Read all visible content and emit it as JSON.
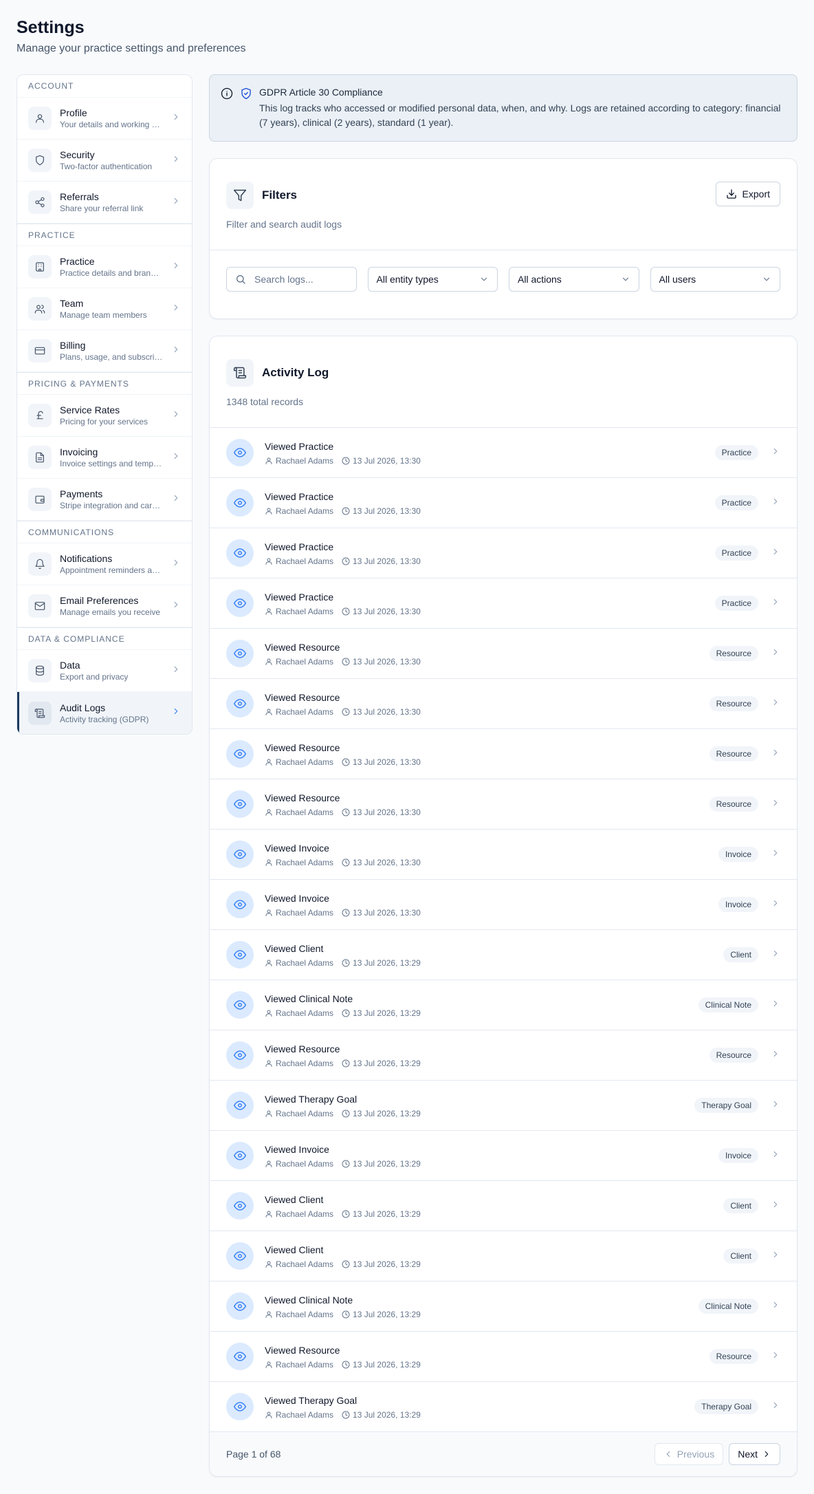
{
  "header": {
    "title": "Settings",
    "subtitle": "Manage your practice settings and preferences"
  },
  "sidebar": {
    "groups": [
      {
        "title": "Account",
        "items": [
          {
            "label": "Profile",
            "desc": "Your details and working hours",
            "icon": "user-icon"
          },
          {
            "label": "Security",
            "desc": "Two-factor authentication",
            "icon": "shield-icon"
          },
          {
            "label": "Referrals",
            "desc": "Share your referral link",
            "icon": "share-icon"
          }
        ]
      },
      {
        "title": "Practice",
        "items": [
          {
            "label": "Practice",
            "desc": "Practice details and branding",
            "icon": "building-icon"
          },
          {
            "label": "Team",
            "desc": "Manage team members",
            "icon": "users-icon"
          },
          {
            "label": "Billing",
            "desc": "Plans, usage, and subscription",
            "icon": "credit-card-icon"
          }
        ]
      },
      {
        "title": "Pricing & Payments",
        "items": [
          {
            "label": "Service Rates",
            "desc": "Pricing for your services",
            "icon": "pound-icon"
          },
          {
            "label": "Invoicing",
            "desc": "Invoice settings and templates",
            "icon": "file-text-icon"
          },
          {
            "label": "Payments",
            "desc": "Stripe integration and card payments",
            "icon": "wallet-icon"
          }
        ]
      },
      {
        "title": "Communications",
        "items": [
          {
            "label": "Notifications",
            "desc": "Appointment reminders and alerts",
            "icon": "bell-icon"
          },
          {
            "label": "Email Preferences",
            "desc": "Manage emails you receive",
            "icon": "mail-icon"
          }
        ]
      },
      {
        "title": "Data & Compliance",
        "items": [
          {
            "label": "Data",
            "desc": "Export and privacy",
            "icon": "database-icon"
          },
          {
            "label": "Audit Logs",
            "desc": "Activity tracking (GDPR)",
            "icon": "scroll-icon",
            "active": true
          }
        ]
      }
    ]
  },
  "alert": {
    "title": "GDPR Article 30 Compliance",
    "text": "This log tracks who accessed or modified personal data, when, and why. Logs are retained according to category: financial (7 years), clinical (2 years), standard (1 year)."
  },
  "filters": {
    "title": "Filters",
    "subtitle": "Filter and search audit logs",
    "export_label": "Export",
    "search_placeholder": "Search logs...",
    "entity_type": "All entity types",
    "action": "All actions",
    "user": "All users"
  },
  "activity": {
    "title": "Activity Log",
    "subtitle": "1348 total records",
    "rows": [
      {
        "title": "Viewed Practice",
        "user": "Rachael Adams",
        "time": "13 Jul 2026, 13:30",
        "badge": "Practice"
      },
      {
        "title": "Viewed Practice",
        "user": "Rachael Adams",
        "time": "13 Jul 2026, 13:30",
        "badge": "Practice"
      },
      {
        "title": "Viewed Practice",
        "user": "Rachael Adams",
        "time": "13 Jul 2026, 13:30",
        "badge": "Practice"
      },
      {
        "title": "Viewed Practice",
        "user": "Rachael Adams",
        "time": "13 Jul 2026, 13:30",
        "badge": "Practice"
      },
      {
        "title": "Viewed Resource",
        "user": "Rachael Adams",
        "time": "13 Jul 2026, 13:30",
        "badge": "Resource"
      },
      {
        "title": "Viewed Resource",
        "user": "Rachael Adams",
        "time": "13 Jul 2026, 13:30",
        "badge": "Resource"
      },
      {
        "title": "Viewed Resource",
        "user": "Rachael Adams",
        "time": "13 Jul 2026, 13:30",
        "badge": "Resource"
      },
      {
        "title": "Viewed Resource",
        "user": "Rachael Adams",
        "time": "13 Jul 2026, 13:30",
        "badge": "Resource"
      },
      {
        "title": "Viewed Invoice",
        "user": "Rachael Adams",
        "time": "13 Jul 2026, 13:30",
        "badge": "Invoice"
      },
      {
        "title": "Viewed Invoice",
        "user": "Rachael Adams",
        "time": "13 Jul 2026, 13:30",
        "badge": "Invoice"
      },
      {
        "title": "Viewed Client",
        "user": "Rachael Adams",
        "time": "13 Jul 2026, 13:29",
        "badge": "Client"
      },
      {
        "title": "Viewed Clinical Note",
        "user": "Rachael Adams",
        "time": "13 Jul 2026, 13:29",
        "badge": "Clinical Note"
      },
      {
        "title": "Viewed Resource",
        "user": "Rachael Adams",
        "time": "13 Jul 2026, 13:29",
        "badge": "Resource"
      },
      {
        "title": "Viewed Therapy Goal",
        "user": "Rachael Adams",
        "time": "13 Jul 2026, 13:29",
        "badge": "Therapy Goal"
      },
      {
        "title": "Viewed Invoice",
        "user": "Rachael Adams",
        "time": "13 Jul 2026, 13:29",
        "badge": "Invoice"
      },
      {
        "title": "Viewed Client",
        "user": "Rachael Adams",
        "time": "13 Jul 2026, 13:29",
        "badge": "Client"
      },
      {
        "title": "Viewed Client",
        "user": "Rachael Adams",
        "time": "13 Jul 2026, 13:29",
        "badge": "Client"
      },
      {
        "title": "Viewed Clinical Note",
        "user": "Rachael Adams",
        "time": "13 Jul 2026, 13:29",
        "badge": "Clinical Note"
      },
      {
        "title": "Viewed Resource",
        "user": "Rachael Adams",
        "time": "13 Jul 2026, 13:29",
        "badge": "Resource"
      },
      {
        "title": "Viewed Therapy Goal",
        "user": "Rachael Adams",
        "time": "13 Jul 2026, 13:29",
        "badge": "Therapy Goal"
      }
    ]
  },
  "pagination": {
    "text": "Page 1 of 68",
    "prev_label": "Previous",
    "next_label": "Next"
  },
  "colors": {
    "accent": "#3b82f6",
    "active_bar": "#1e3a5f",
    "alert_bg": "#eaf0f5"
  }
}
